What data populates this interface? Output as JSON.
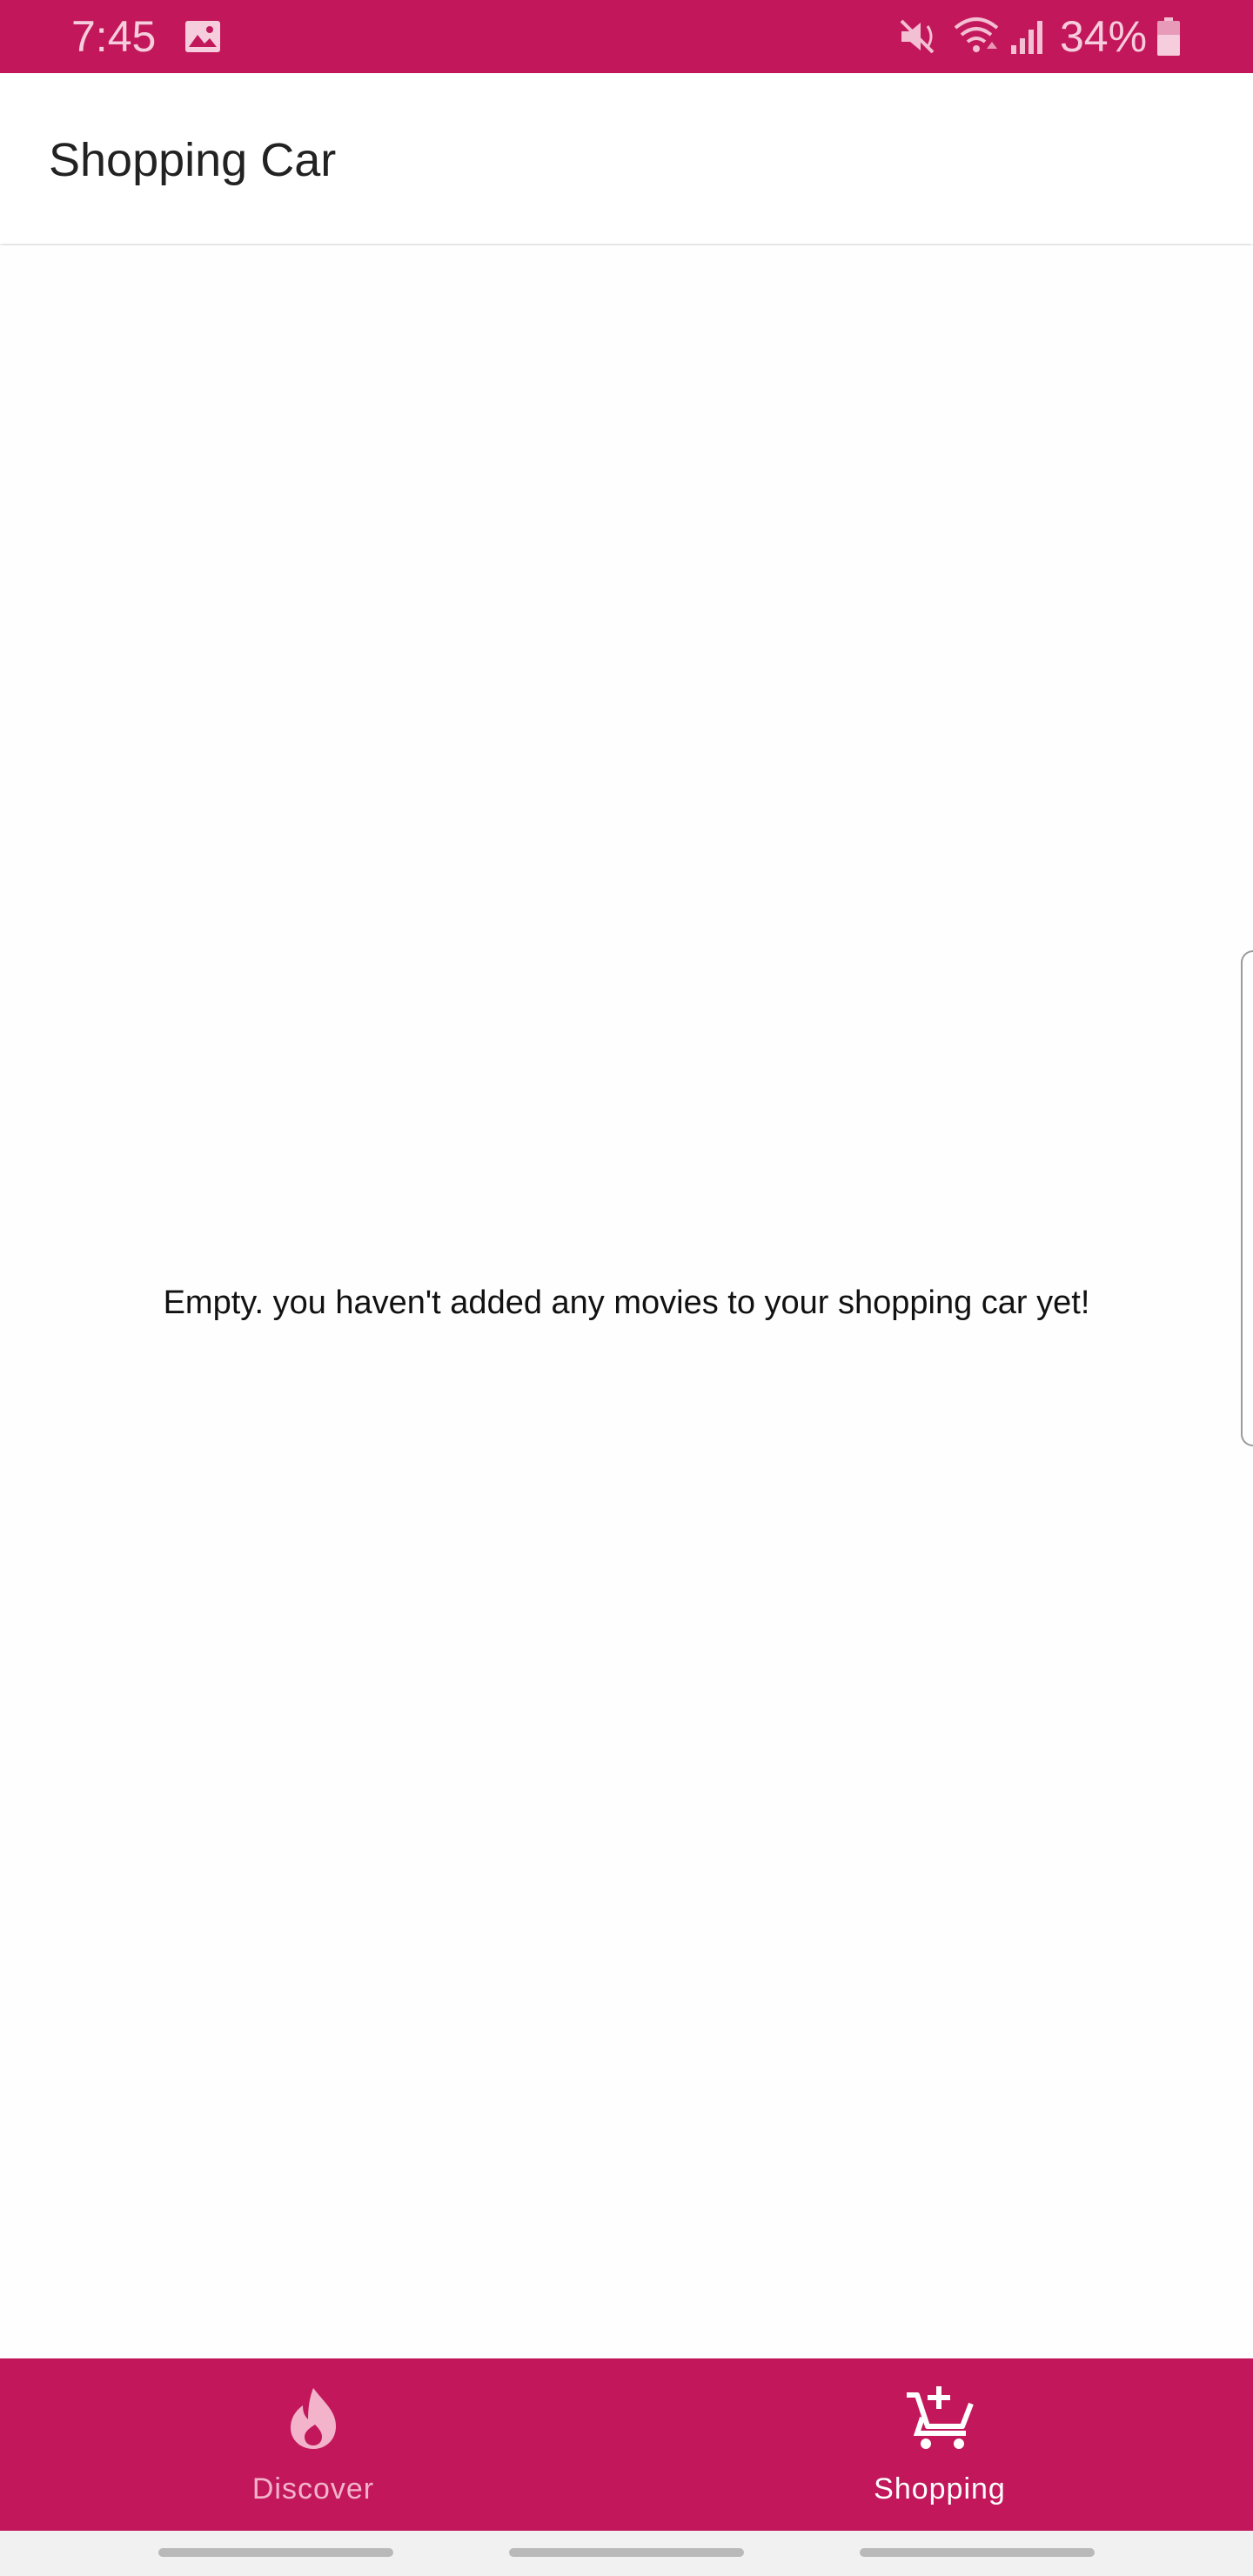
{
  "status_bar": {
    "time": "7:45",
    "battery": "34%",
    "background_color": "#c2185b",
    "icons": [
      "image-icon",
      "mute-icon",
      "wifi-icon",
      "signal-icon",
      "battery-icon"
    ]
  },
  "app_bar": {
    "title": "Shopping Car"
  },
  "content": {
    "empty_message": "Empty. you haven't added any movies to your shopping car yet!"
  },
  "bottom_nav": {
    "background_color": "#c2185b",
    "items": [
      {
        "label": "Discover",
        "icon": "flame-icon",
        "selected": false
      },
      {
        "label": "Shopping",
        "icon": "add-shopping-cart-icon",
        "selected": true
      }
    ]
  },
  "system_nav": {
    "buttons": [
      "recent-apps",
      "home",
      "back"
    ]
  }
}
